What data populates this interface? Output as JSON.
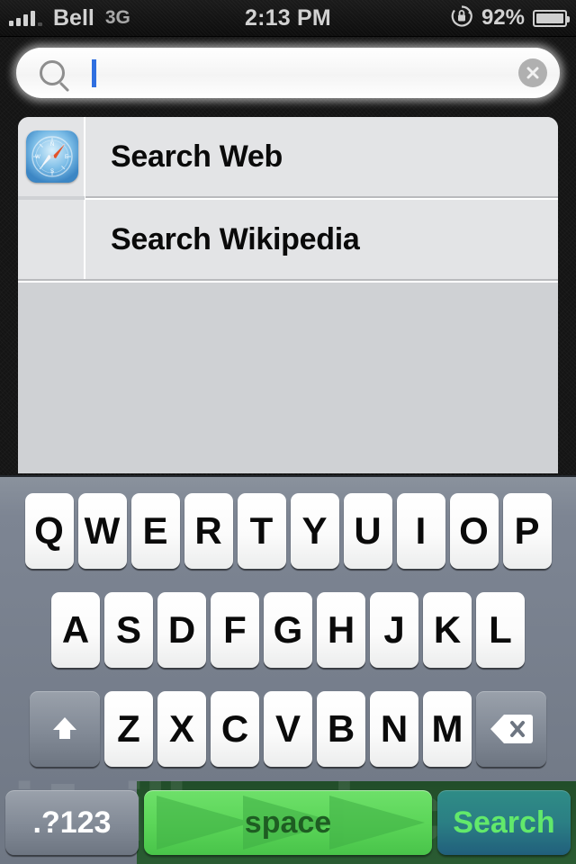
{
  "statusbar": {
    "carrier": "Bell",
    "network": "3G",
    "time": "2:13 PM",
    "battery_percent": "92%",
    "signal_icon": "signal-bars-icon",
    "rotation_lock_icon": "rotation-lock-icon",
    "battery_icon": "battery-icon"
  },
  "search": {
    "value": "",
    "placeholder": "",
    "magnifier_icon": "search-icon",
    "clear_icon": "clear-circle-icon"
  },
  "results": {
    "rows": [
      {
        "label": "Search Web",
        "icon": "safari-compass-icon",
        "has_icon": true
      },
      {
        "label": "Search Wikipedia",
        "icon": "",
        "has_icon": false
      }
    ]
  },
  "keyboard": {
    "row1": [
      "Q",
      "W",
      "E",
      "R",
      "T",
      "Y",
      "U",
      "I",
      "O",
      "P"
    ],
    "row2": [
      "A",
      "S",
      "D",
      "F",
      "G",
      "H",
      "J",
      "K",
      "L"
    ],
    "row3": [
      "Z",
      "X",
      "C",
      "V",
      "B",
      "N",
      "M"
    ],
    "shift_icon": "shift-up-arrow-icon",
    "backspace_icon": "backspace-delete-icon",
    "numeric_label": ".?123",
    "space_label": "space",
    "search_label": "Search",
    "space_arrow_icon": "play-triangle-icon"
  },
  "watermark": {
    "text": "iJailbreak.com"
  },
  "colors": {
    "caret": "#2f6fe0",
    "space_key": "#5cd659",
    "search_key": "#215f7c",
    "search_key_text": "#62e96b",
    "keyboard_bg": "#7d8593",
    "row_bg": "#e3e4e6",
    "list_bg": "#cfd1d4"
  }
}
